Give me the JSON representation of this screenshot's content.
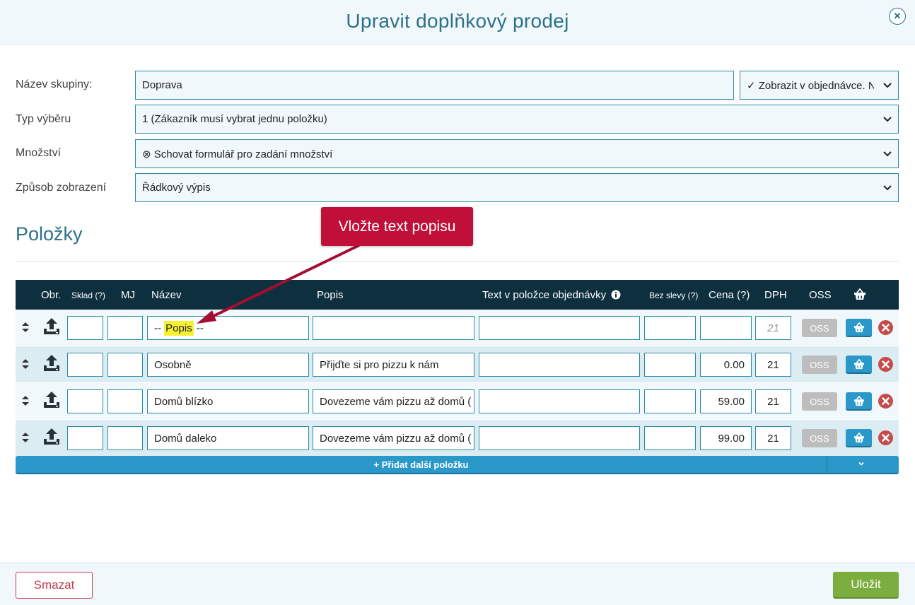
{
  "dialog": {
    "title": "Upravit doplňkový prodej",
    "close_icon": "close-icon"
  },
  "form": {
    "group_name_label": "Název skupiny:",
    "group_name_value": "Doprava",
    "display_select_value": "✓ Zobrazit v objednávce. N",
    "selection_type_label": "Typ výběru",
    "selection_type_value": "1 (Zákazník musí vybrat jednu položku)",
    "quantity_label": "Množství",
    "quantity_value": "⊗ Schovat formulář pro zadání množství",
    "display_mode_label": "Způsob zobrazení",
    "display_mode_value": "Řádkový výpis"
  },
  "section": {
    "title": "Položky"
  },
  "callout": {
    "text": "Vložte text popisu",
    "color": "#c0103a"
  },
  "table": {
    "headers": {
      "image": "Obr.",
      "stock": "Sklad (?)",
      "unit": "MJ",
      "name": "Název",
      "description": "Popis",
      "order_text": "Text v položce objednávky",
      "no_discount": "Bez slevy (?)",
      "price": "Cena (?)",
      "vat": "DPH",
      "oss": "OSS"
    },
    "rows": [
      {
        "name_prefix": "-- ",
        "name_highlight": "Popis",
        "name_suffix": " --",
        "description": "",
        "order_text": "",
        "no_discount": "",
        "price": "",
        "vat": "21",
        "oss": "OSS"
      },
      {
        "name": "Osobně",
        "description": "Přijďte si pro pizzu k nám",
        "order_text": "",
        "no_discount": "",
        "price": "0.00",
        "vat": "21",
        "oss": "OSS"
      },
      {
        "name": "Domů blízko",
        "description": "Dovezeme vám pizzu až domů (",
        "order_text": "",
        "no_discount": "",
        "price": "59.00",
        "vat": "21",
        "oss": "OSS"
      },
      {
        "name": "Domů daleko",
        "description": "Dovezeme vám pizzu až domů (",
        "order_text": "",
        "no_discount": "",
        "price": "99.00",
        "vat": "21",
        "oss": "OSS"
      }
    ],
    "add_item_label": "+ Přidat další položku"
  },
  "footer": {
    "delete_label": "Smazat",
    "save_label": "Uložit"
  },
  "colors": {
    "accent": "#2b7189",
    "header_dark": "#0e2f3d",
    "button_blue": "#2a98c9",
    "save_green": "#7cae3f",
    "delete_red": "#c43a4d"
  }
}
